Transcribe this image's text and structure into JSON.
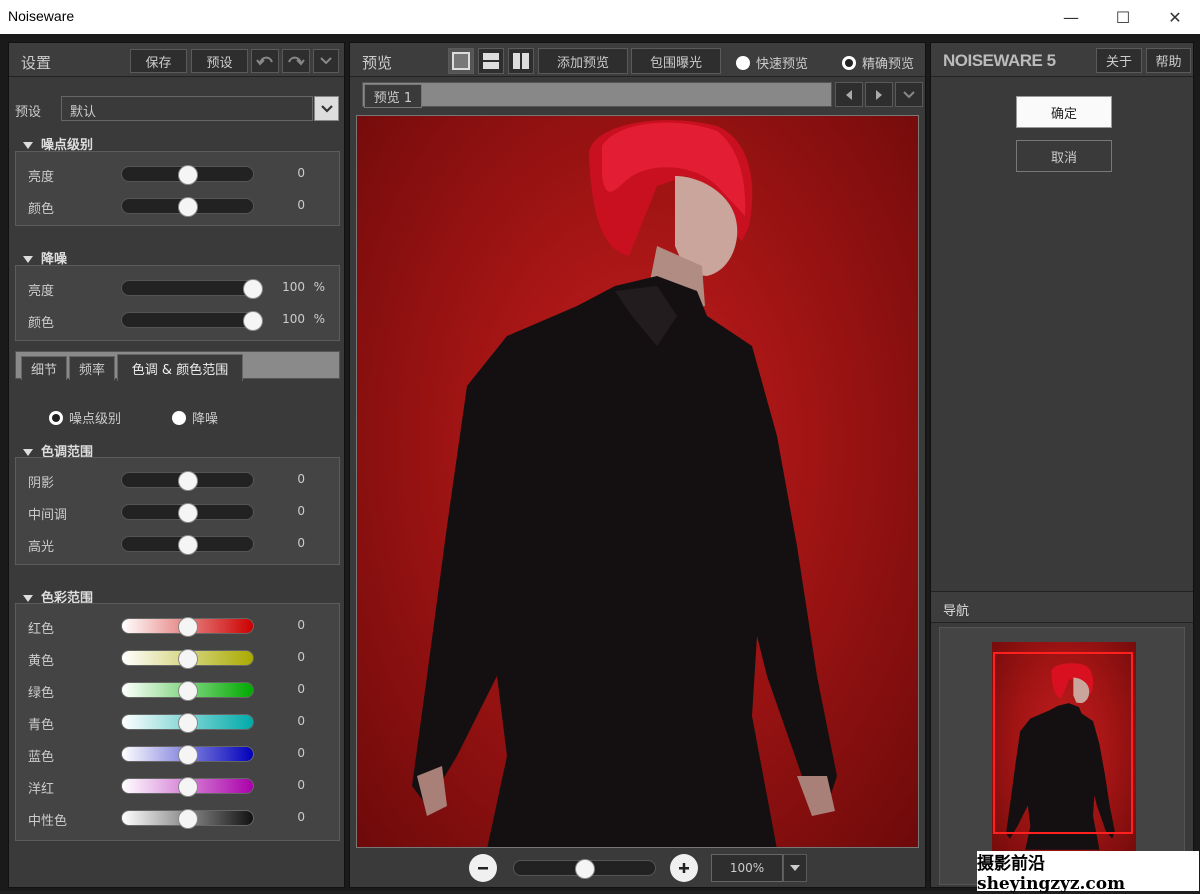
{
  "window": {
    "title": "Noiseware",
    "minimize": "—",
    "maximize": "☐",
    "close": "✕"
  },
  "settings": {
    "header_label": "设置",
    "save_label": "保存",
    "preset_btn_label": "预设",
    "preset_label": "预设",
    "preset_value": "默认",
    "noise_level": {
      "title": "噪点级别",
      "rows": [
        {
          "label": "亮度",
          "value": "0",
          "position": 0.5
        },
        {
          "label": "颜色",
          "value": "0",
          "position": 0.5
        }
      ]
    },
    "denoise": {
      "title": "降噪",
      "rows": [
        {
          "label": "亮度",
          "value": "100",
          "unit": "%",
          "position": 1.0
        },
        {
          "label": "颜色",
          "value": "100",
          "unit": "%",
          "position": 1.0
        }
      ]
    },
    "tabs": [
      "细节",
      "频率",
      "色调 & 颜色范围"
    ],
    "radio_options": [
      {
        "label": "噪点级别",
        "selected": true
      },
      {
        "label": "降噪",
        "selected": false
      }
    ],
    "tone_range": {
      "title": "色调范围",
      "rows": [
        {
          "label": "阴影",
          "value": "0",
          "position": 0.5
        },
        {
          "label": "中间调",
          "value": "0",
          "position": 0.5
        },
        {
          "label": "高光",
          "value": "0",
          "position": 0.5
        }
      ]
    },
    "color_range": {
      "title": "色彩范围",
      "rows": [
        {
          "label": "红色",
          "value": "0",
          "position": 0.5,
          "color": "#cc0000"
        },
        {
          "label": "黄色",
          "value": "0",
          "position": 0.5,
          "color": "#aaaa00"
        },
        {
          "label": "绿色",
          "value": "0",
          "position": 0.5,
          "color": "#00aa00"
        },
        {
          "label": "青色",
          "value": "0",
          "position": 0.5,
          "color": "#00aaaa"
        },
        {
          "label": "蓝色",
          "value": "0",
          "position": 0.5,
          "color": "#0000bb"
        },
        {
          "label": "洋红",
          "value": "0",
          "position": 0.5,
          "color": "#aa00aa"
        },
        {
          "label": "中性色",
          "value": "0",
          "position": 0.5,
          "color": "#111111"
        }
      ]
    }
  },
  "preview": {
    "header_label": "预览",
    "add_preview_label": "添加预览",
    "bracket_label": "包围曝光",
    "fast_preview_label": "快速预览",
    "precise_preview_label": "精确预览",
    "tab_label": "预览 1",
    "zoom_value": "100%"
  },
  "right": {
    "brand": "NOISEWARE 5",
    "about_label": "关于",
    "help_label": "帮助",
    "ok_label": "确定",
    "cancel_label": "取消",
    "navigation_label": "导航"
  },
  "watermark": "摄影前沿 sheyingzyz.com"
}
